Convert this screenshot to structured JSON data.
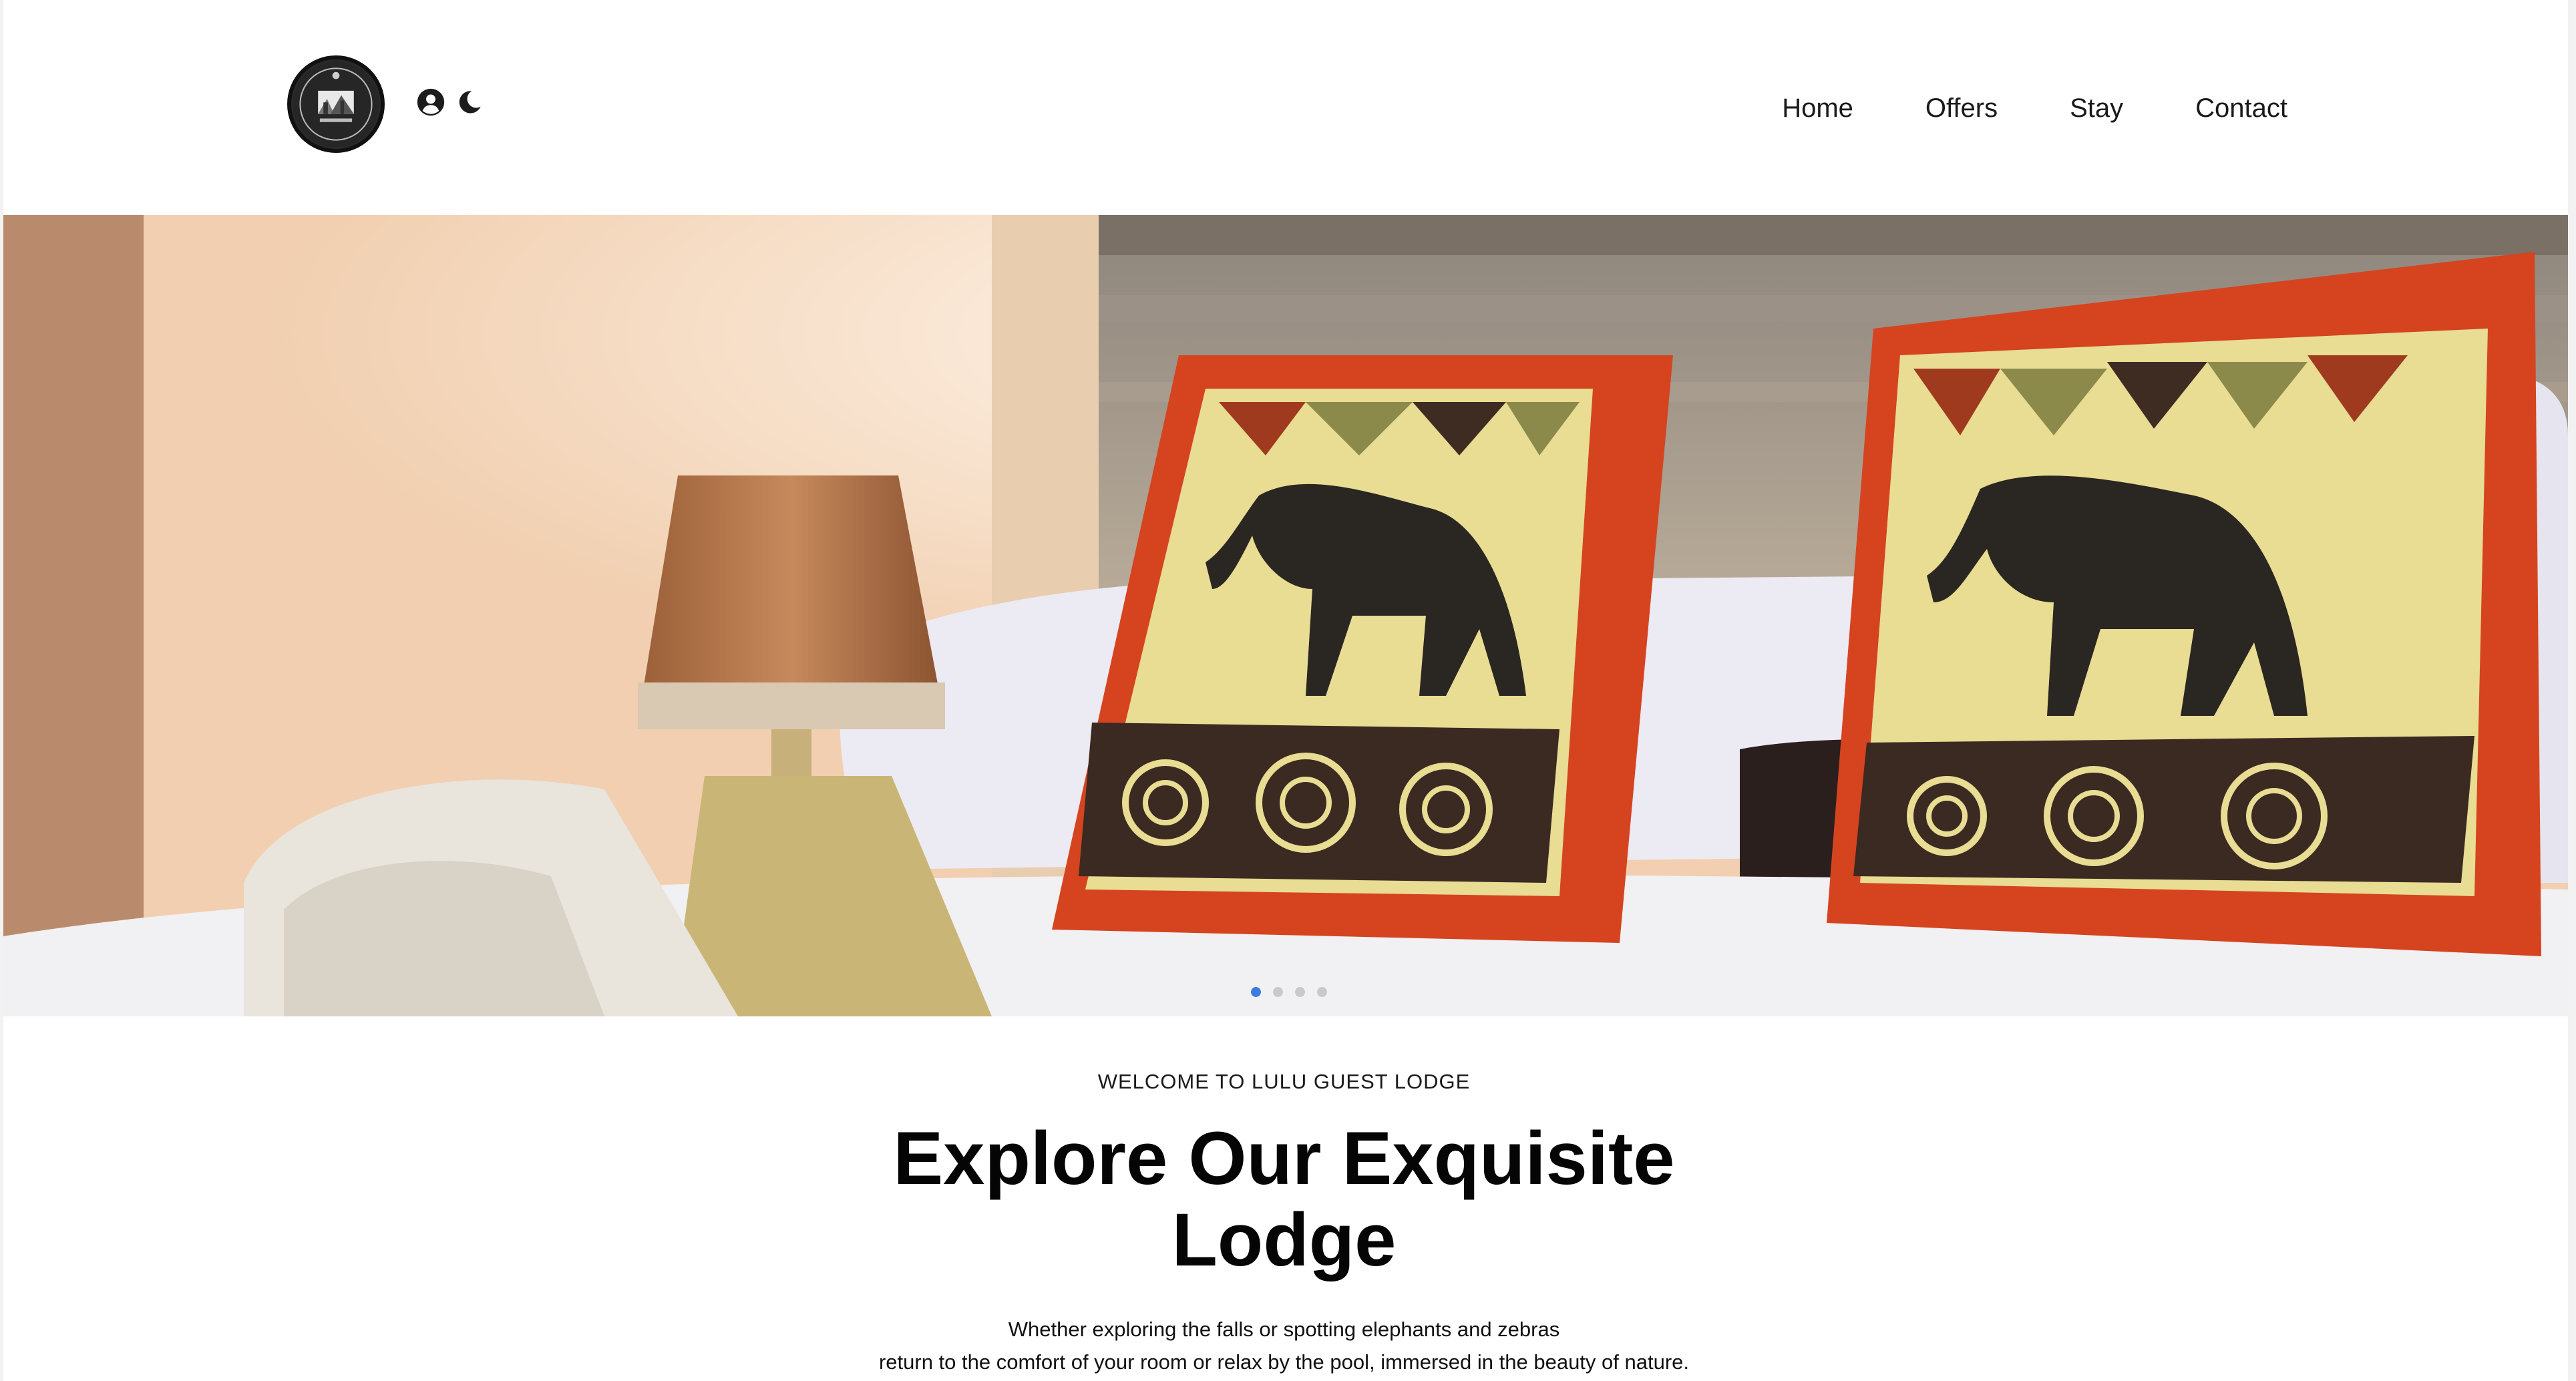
{
  "header": {
    "logo_name": "lodge-logo",
    "icons": [
      "user-icon",
      "moon-icon"
    ],
    "nav": [
      "Home",
      "Offers",
      "Stay",
      "Contact"
    ]
  },
  "hero": {
    "slide_count": 4,
    "active_slide": 1,
    "dot_active_color": "#3b7ddd"
  },
  "intro": {
    "eyebrow": "WELCOME TO LULU GUEST LODGE",
    "headline_line1": "Explore Our Exquisite",
    "headline_line2": "Lodge",
    "para_line1": "Whether exploring the falls or spotting elephants and zebras",
    "para_line2": "return to the comfort of your room or relax by the pool, immersed in the beauty of nature."
  }
}
